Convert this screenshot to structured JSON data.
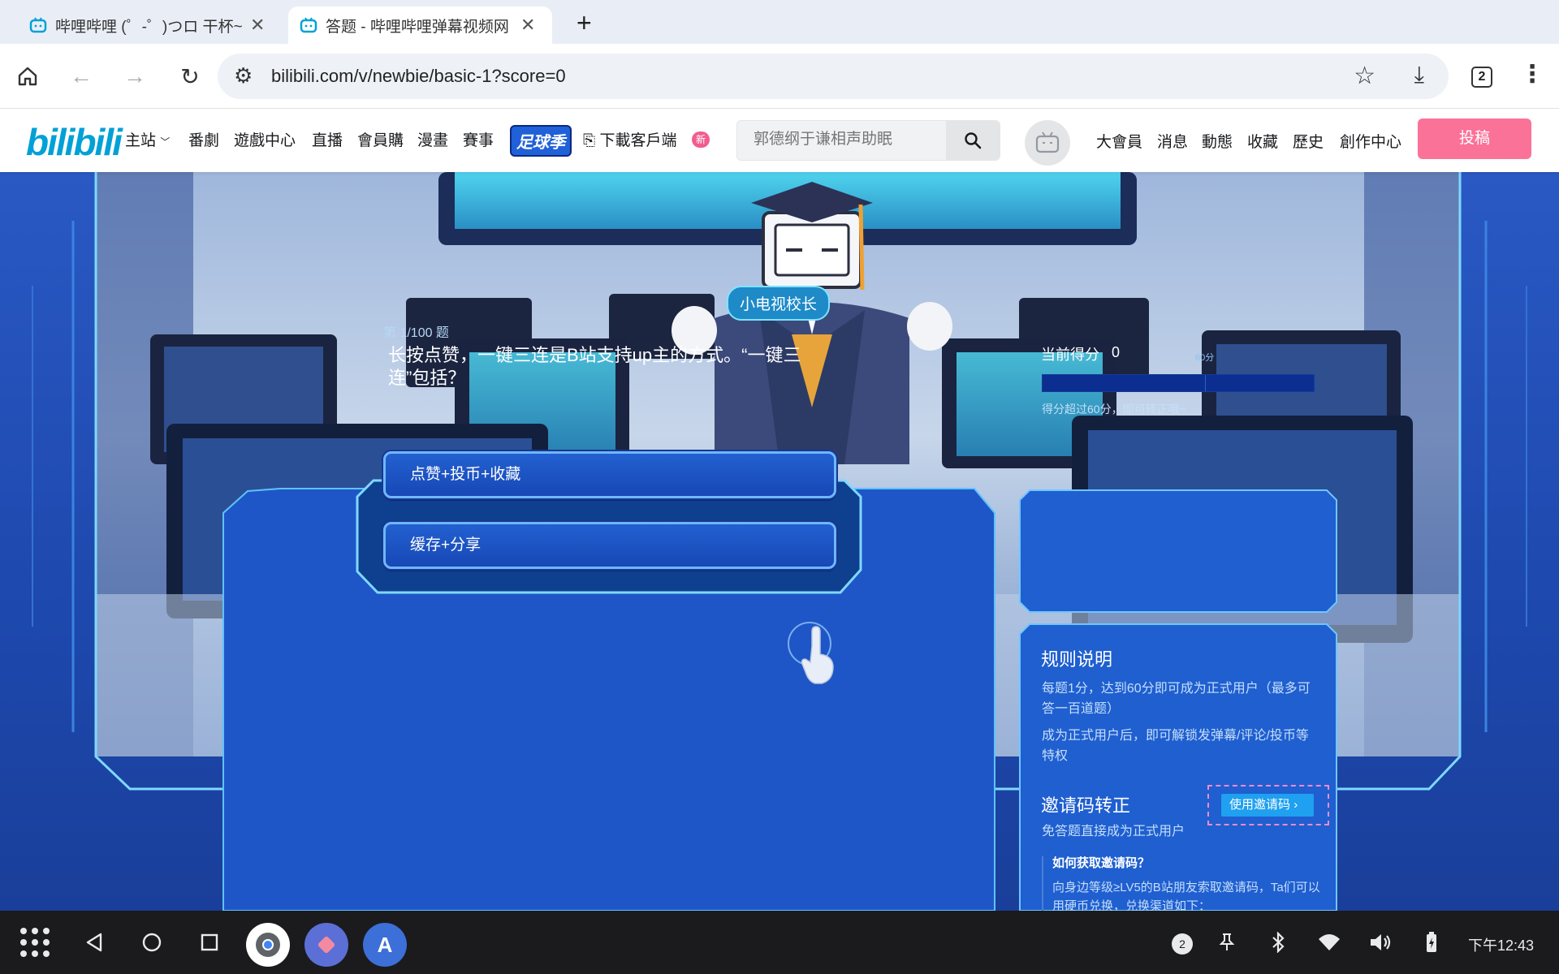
{
  "browser": {
    "tabs": [
      {
        "title": "哔哩哔哩 (゜-゜)つロ 干杯~-",
        "active": false
      },
      {
        "title": "答题 - 哔哩哔哩弹幕视频网 -",
        "active": true
      }
    ],
    "url": "bilibili.com/v/newbie/basic-1?score=0",
    "tab_count": "2"
  },
  "site": {
    "logo": "bilibili",
    "nav": [
      "主站",
      "番劇",
      "遊戲中心",
      "直播",
      "會員購",
      "漫畫",
      "賽事"
    ],
    "worldcup": "足球季",
    "download": "下載客戶端",
    "new_badge": "新",
    "search_placeholder": "郭德纲于谦相声助眠",
    "right_nav": [
      "大會員",
      "消息",
      "動態",
      "收藏",
      "歷史",
      "創作中心"
    ],
    "upload": "投稿"
  },
  "quiz": {
    "mascot_name": "小电视校长",
    "progress": "第 1/100 题",
    "question": "长按点赞，一键三连是B站支持up主的方式。“一键三连”包括？",
    "options": [
      "点赞+投币+收藏",
      "缓存+分享"
    ]
  },
  "score": {
    "label": "当前得分",
    "value": "0",
    "threshold_label": "60分",
    "fill_fraction": 0,
    "hint": "得分超过60分，即可转正哦~"
  },
  "rules": {
    "title": "规则说明",
    "lines": [
      "每题1分，达到60分即可成为正式用户（最多可答一百道题）",
      "成为正式用户后，即可解锁发弹幕/评论/投币等特权"
    ],
    "invite_title": "邀请码转正",
    "invite_sub": "免答题直接成为正式用户",
    "invite_button": "使用邀请码",
    "how_title": "如何获取邀请码？",
    "how_text": "向身边等级≥LV5的B站朋友索取邀请码，Ta们可以用硬币兑换，兑换渠道如下："
  },
  "shelf": {
    "notifications": "2",
    "time": "下午12:43"
  },
  "colors": {
    "bilibili_blue": "#00a1d6",
    "upload_pink": "#fb7299",
    "scene_blue": "#1d48ad",
    "accent_cyan": "#7fe3ff"
  }
}
